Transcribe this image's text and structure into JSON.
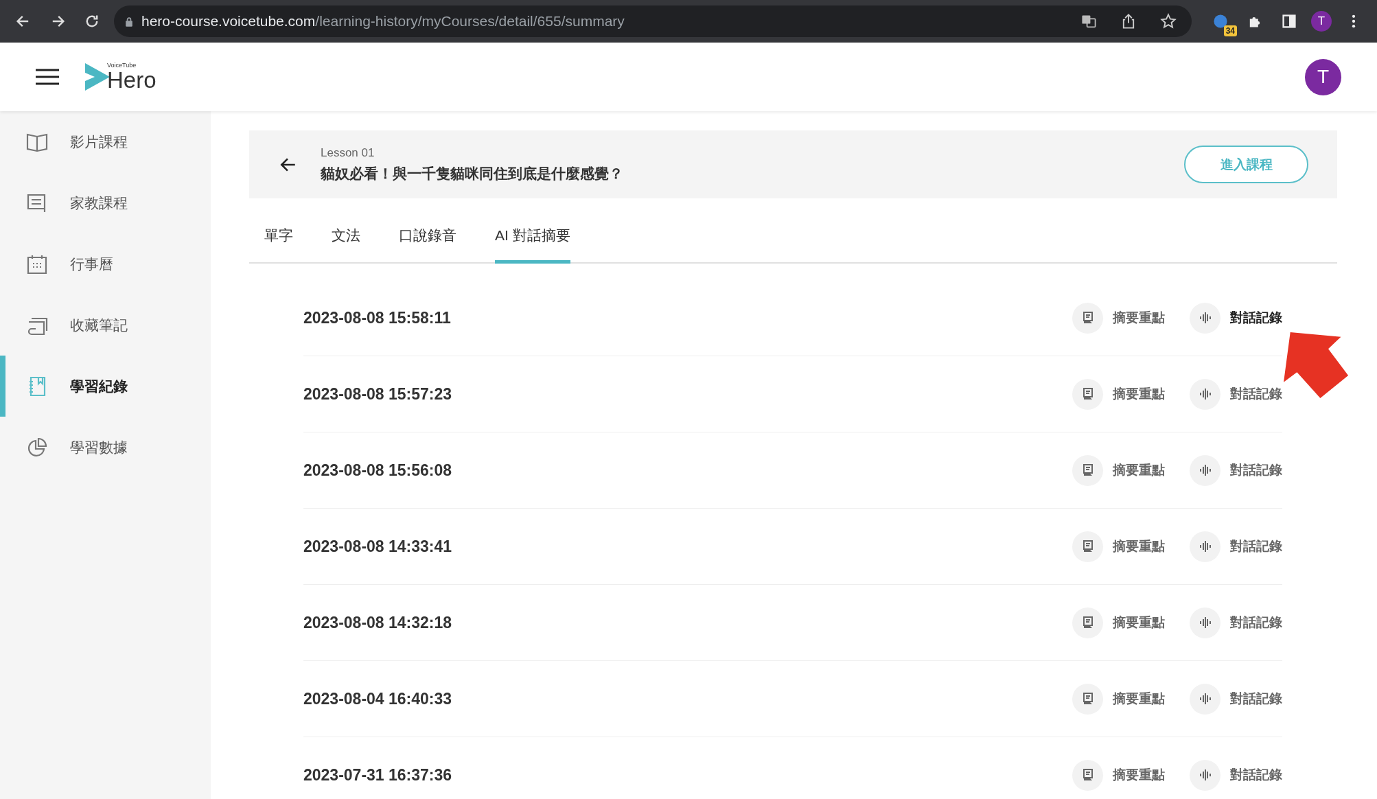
{
  "browser": {
    "url_host": "hero-course.voicetube.com",
    "url_path": "/learning-history/myCourses/detail/655/summary",
    "extension_badge": "34",
    "profile_initial": "T"
  },
  "header": {
    "logo_small": "VoiceTube",
    "logo": "Hero",
    "avatar_initial": "T"
  },
  "sidebar": {
    "items": [
      {
        "label": "影片課程",
        "kind": "book",
        "selected": false
      },
      {
        "label": "家教課程",
        "kind": "chat",
        "selected": false
      },
      {
        "label": "行事曆",
        "kind": "calendar",
        "selected": false
      },
      {
        "label": "收藏筆記",
        "kind": "notes",
        "selected": false
      },
      {
        "label": "學習紀錄",
        "kind": "notebook",
        "selected": true
      },
      {
        "label": "學習數據",
        "kind": "pie",
        "selected": false
      }
    ]
  },
  "lesson": {
    "number": "Lesson 01",
    "title": "貓奴必看！與一千隻貓咪同住到底是什麼感覺？",
    "enter_button": "進入課程"
  },
  "tabs": [
    {
      "label": "單字",
      "selected": false
    },
    {
      "label": "文法",
      "selected": false
    },
    {
      "label": "口說錄音",
      "selected": false
    },
    {
      "label": "AI 對話摘要",
      "selected": true
    }
  ],
  "records": [
    {
      "datetime": "2023-08-08 15:58:11",
      "summary_button": "摘要重點",
      "transcript_button": "對話記錄",
      "transcript_highlighted": true
    },
    {
      "datetime": "2023-08-08 15:57:23",
      "summary_button": "摘要重點",
      "transcript_button": "對話記錄",
      "transcript_highlighted": false
    },
    {
      "datetime": "2023-08-08 15:56:08",
      "summary_button": "摘要重點",
      "transcript_button": "對話記錄",
      "transcript_highlighted": false
    },
    {
      "datetime": "2023-08-08 14:33:41",
      "summary_button": "摘要重點",
      "transcript_button": "對話記錄",
      "transcript_highlighted": false
    },
    {
      "datetime": "2023-08-08 14:32:18",
      "summary_button": "摘要重點",
      "transcript_button": "對話記錄",
      "transcript_highlighted": false
    },
    {
      "datetime": "2023-08-04 16:40:33",
      "summary_button": "摘要重點",
      "transcript_button": "對話記錄",
      "transcript_highlighted": false
    },
    {
      "datetime": "2023-07-31 16:37:36",
      "summary_button": "摘要重點",
      "transcript_button": "對話記錄",
      "transcript_highlighted": false
    }
  ]
}
